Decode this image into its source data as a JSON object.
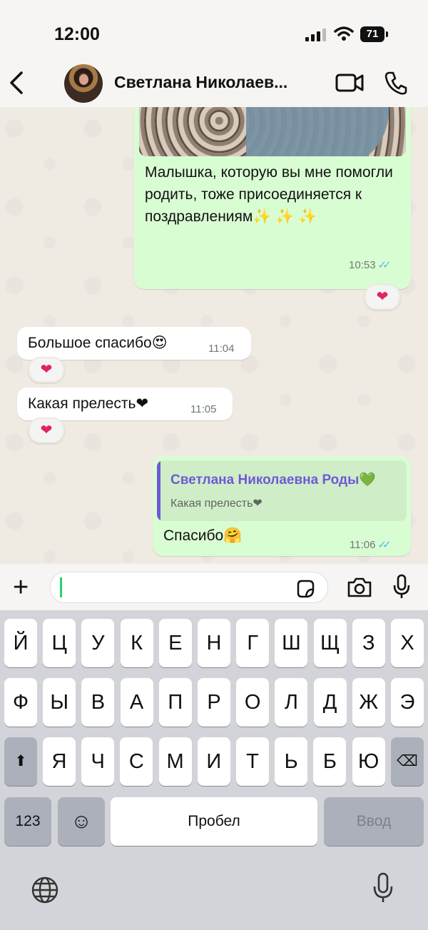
{
  "status": {
    "time": "12:00",
    "battery": "71"
  },
  "header": {
    "contact_name": "Светлана Николаев..."
  },
  "messages": {
    "photo_caption": "Малышка, которую вы мне помогли родить, тоже присоединяется к поздравлениям✨ ✨ ✨",
    "photo_time": "10:53",
    "photo_reaction": "❤",
    "m1_text": "Большое спасибо😍",
    "m1_time": "11:04",
    "m1_reaction": "❤",
    "m2_text": "Какая прелесть❤",
    "m2_time": "11:05",
    "m2_reaction": "❤",
    "reply_author": "Светлана Николаевна Роды💚",
    "reply_quote": "Какая прелесть❤",
    "reply_text": "Спасибо🤗",
    "reply_time": "11:06",
    "ticks": "✓✓"
  },
  "input": {
    "value": ""
  },
  "keyboard": {
    "row1": [
      "Й",
      "Ц",
      "У",
      "К",
      "Е",
      "Н",
      "Г",
      "Ш",
      "Щ",
      "З",
      "Х"
    ],
    "row2": [
      "Ф",
      "Ы",
      "В",
      "А",
      "П",
      "Р",
      "О",
      "Л",
      "Д",
      "Ж",
      "Э"
    ],
    "row3": [
      "Я",
      "Ч",
      "С",
      "М",
      "И",
      "Т",
      "Ь",
      "Б",
      "Ю"
    ],
    "num_key": "123",
    "emoji_key": "☺",
    "space": "Пробел",
    "enter": "Ввод",
    "shift": "⬆",
    "backspace": "⌫"
  },
  "colors": {
    "outgoing": "#d9fdd3",
    "incoming": "#ffffff",
    "tick": "#53bdeb",
    "accent": "#25d366",
    "quote_author": "#6f59d6"
  }
}
